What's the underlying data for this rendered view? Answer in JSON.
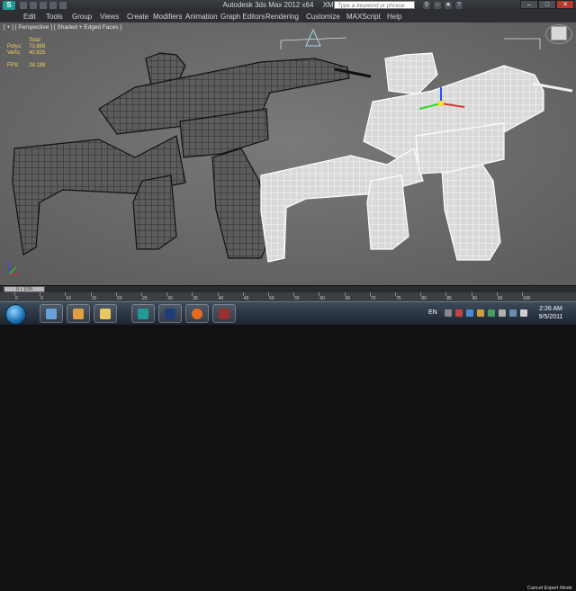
{
  "titlebar": {
    "app_title": "Autodesk 3ds Max  2012 x64",
    "file_name": "XM8.max",
    "search_placeholder": "Type a keyword or phrase",
    "app_logo_letter": "S"
  },
  "menu": {
    "items": [
      "Edit",
      "Tools",
      "Group",
      "Views",
      "Create",
      "Modifiers",
      "Animation",
      "Graph Editors",
      "Rendering",
      "Customize",
      "MAXScript",
      "Help"
    ]
  },
  "viewport": {
    "label": "[ + ] [ Perspective ] [ Shaded + Edged Faces ]",
    "stats": {
      "header": "Total",
      "polys_label": "Polys:",
      "polys_value": "73,888",
      "verts_label": "Verts:",
      "verts_value": "40,925",
      "fps_label": "FPS:",
      "fps_value": "28.188"
    },
    "colors": {
      "background": "#6e6e6e",
      "wire_dark": "#1e1e1e",
      "wire_light": "#f4f4f4"
    }
  },
  "timeline": {
    "slider_label": "0 / 100",
    "tick_labels": [
      "0",
      "5",
      "10",
      "15",
      "20",
      "25",
      "30",
      "35",
      "40",
      "45",
      "50",
      "55",
      "60",
      "65",
      "70",
      "75",
      "80",
      "85",
      "90",
      "95",
      "100"
    ]
  },
  "status": {
    "text": "Cancel Expert Mode"
  },
  "taskbar": {
    "language": "EN",
    "time": "2:26 AM",
    "date": "9/5/2011",
    "pinned_icons": [
      "explorer-icon",
      "media-icon",
      "folder-icon",
      "3dsmax-icon",
      "photoshop-icon",
      "firefox-icon",
      "app-icon"
    ]
  }
}
